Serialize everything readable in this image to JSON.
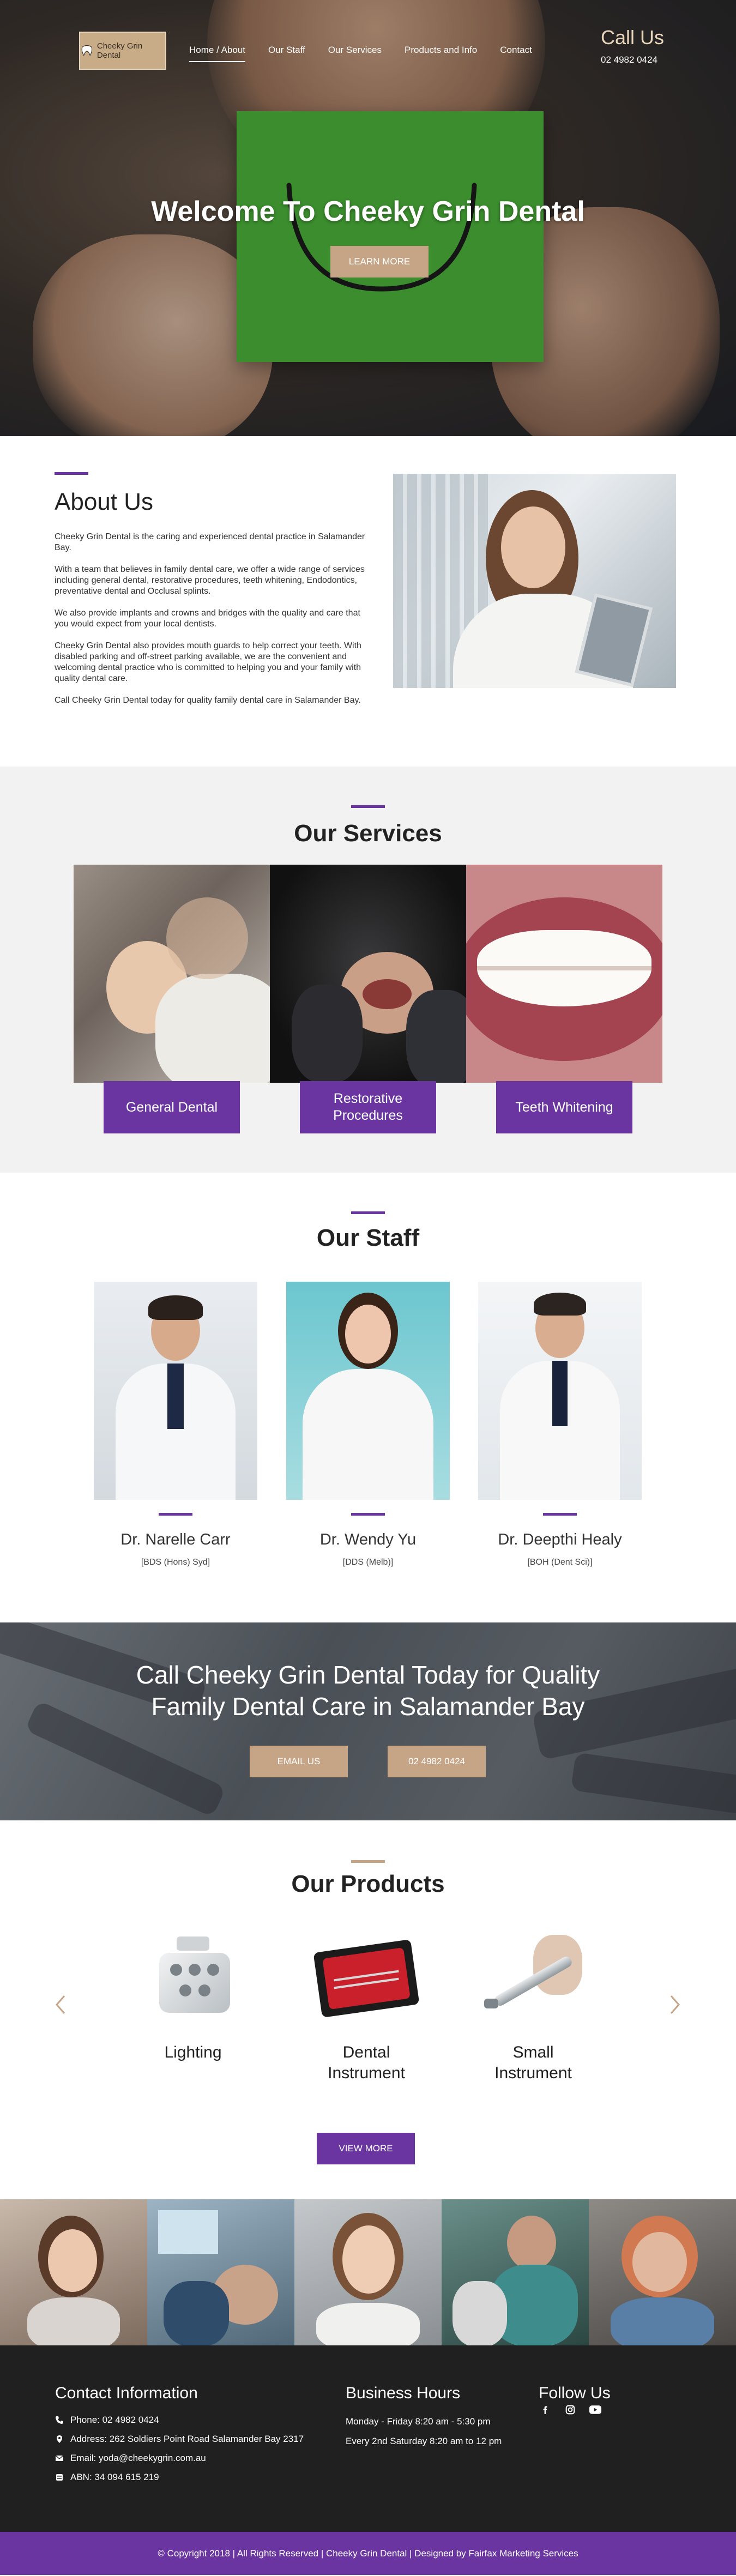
{
  "header": {
    "logo_text": "Cheeky Grin Dental",
    "nav": [
      "Home / About",
      "Our Staff",
      "Our Services",
      "Products and Info",
      "Contact"
    ],
    "call_title": "Call Us",
    "call_phone": "02 4982 0424"
  },
  "hero": {
    "title": "Welcome To Cheeky Grin Dental",
    "button": "LEARN MORE"
  },
  "about": {
    "title": "About Us",
    "paragraphs": [
      "Cheeky Grin Dental is the caring and experienced dental practice in Salamander Bay.",
      "With a team that believes in family dental care, we offer a wide range of services including general dental, restorative procedures, teeth whitening, Endodontics, preventative dental and Occlusal splints.",
      "We also provide implants and crowns and bridges with the quality and care that you would expect from your local dentists.",
      "Cheeky Grin Dental also provides mouth guards to help correct your teeth. With disabled parking and off-street parking available, we are the convenient and welcoming dental practice who is committed to helping you and your family with quality dental care.",
      "Call Cheeky Grin Dental today for quality family dental care in Salamander Bay."
    ]
  },
  "services": {
    "title": "Our Services",
    "items": [
      "General Dental",
      "Restorative Procedures",
      "Teeth Whitening"
    ]
  },
  "staff": {
    "title": "Our Staff",
    "members": [
      {
        "name": "Dr. Narelle Carr",
        "cred": "[BDS (Hons) Syd]"
      },
      {
        "name": "Dr. Wendy Yu",
        "cred": "[DDS (Melb)]"
      },
      {
        "name": "Dr. Deepthi Healy",
        "cred": "[BOH (Dent Sci)]"
      }
    ]
  },
  "cta": {
    "line1": "Call Cheeky Grin Dental Today for Quality",
    "line2": "Family Dental Care in Salamander Bay",
    "email_button": "EMAIL US",
    "phone_button": "02 4982 0424"
  },
  "products": {
    "title": "Our Products",
    "items": [
      {
        "line1": "Lighting",
        "line2": ""
      },
      {
        "line1": "Dental",
        "line2": "Instrument"
      },
      {
        "line1": "Small",
        "line2": "Instrument"
      }
    ],
    "button": "VIEW MORE"
  },
  "footer": {
    "contact_title": "Contact Information",
    "phone": "Phone: 02 4982 0424",
    "address": "Address: 262 Soldiers Point Road Salamander Bay 2317",
    "email": "Email: yoda@cheekygrin.com.au",
    "abn": "ABN: 34 094 615 219",
    "hours_title": "Business Hours",
    "hours_1": "Monday - Friday 8:20 am - 5:30 pm",
    "hours_2": "Every 2nd Saturday 8:20 am to 12 pm",
    "follow_title": "Follow Us",
    "copyright": "© Copyright 2018 | All Rights Reserved | Cheeky Grin Dental | Designed by Fairfax Marketing Services"
  },
  "colors": {
    "purple": "#6a35a0",
    "gold": "#c6a586",
    "dark": "#202020",
    "green_card": "#4cb53b"
  }
}
